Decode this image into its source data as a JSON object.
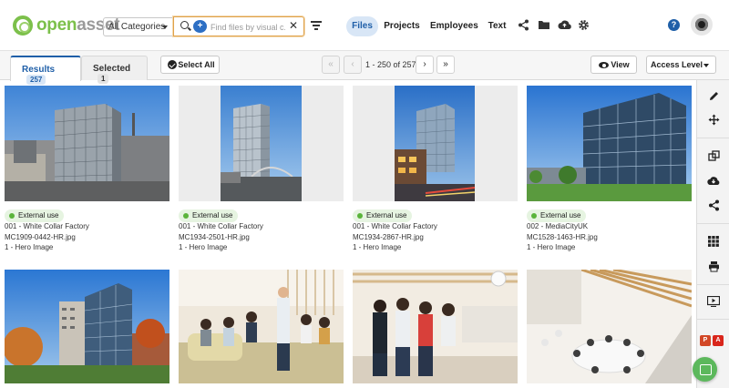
{
  "app": {
    "logo_open": "open",
    "logo_asset": "asset"
  },
  "search": {
    "category": "All Categories",
    "placeholder": "Find files by visual c...",
    "value": ""
  },
  "nav": {
    "tabs": [
      {
        "label": "Files",
        "active": true
      },
      {
        "label": "Projects",
        "active": false
      },
      {
        "label": "Employees",
        "active": false
      },
      {
        "label": "Text",
        "active": false
      }
    ],
    "icons": [
      "share-icon",
      "folder-icon",
      "cloud-upload-icon",
      "settings-icon",
      "help-icon",
      "avatar"
    ]
  },
  "results_tabs": [
    {
      "label": "Results",
      "count": "257",
      "active": true
    },
    {
      "label": "Selected",
      "count": "1",
      "active": false
    }
  ],
  "toolbar": {
    "select_all": "Select All",
    "pager_text": "1 - 250 of 257",
    "view": "View",
    "access_level": "Access Level"
  },
  "files": [
    {
      "tag": "External use",
      "project": "001 - White Collar Factory",
      "filename": "MC1909-0442-HR.jpg",
      "category": "1 - Hero Image"
    },
    {
      "tag": "External use",
      "project": "001 - White Collar Factory",
      "filename": "MC1934-2501-HR.jpg",
      "category": "1 - Hero Image"
    },
    {
      "tag": "External use",
      "project": "001 - White Collar Factory",
      "filename": "MC1934-2867-HR.jpg",
      "category": "1 - Hero Image"
    },
    {
      "tag": "External use",
      "project": "002 - MediaCityUK",
      "filename": "MC1528-1463-HR.jpg",
      "category": "1 - Hero Image"
    }
  ],
  "sidebar_icons": [
    "edit-icon",
    "move-icon",
    "copy-icon",
    "download-icon",
    "share-icon",
    "grid-icon",
    "print-icon",
    "presentation-icon",
    "pdf-icon"
  ],
  "colors": {
    "accent": "#1f5fa8",
    "brand_green": "#7cc04b",
    "tag_green": "#5ab43b",
    "chat": "#5cb85c"
  }
}
